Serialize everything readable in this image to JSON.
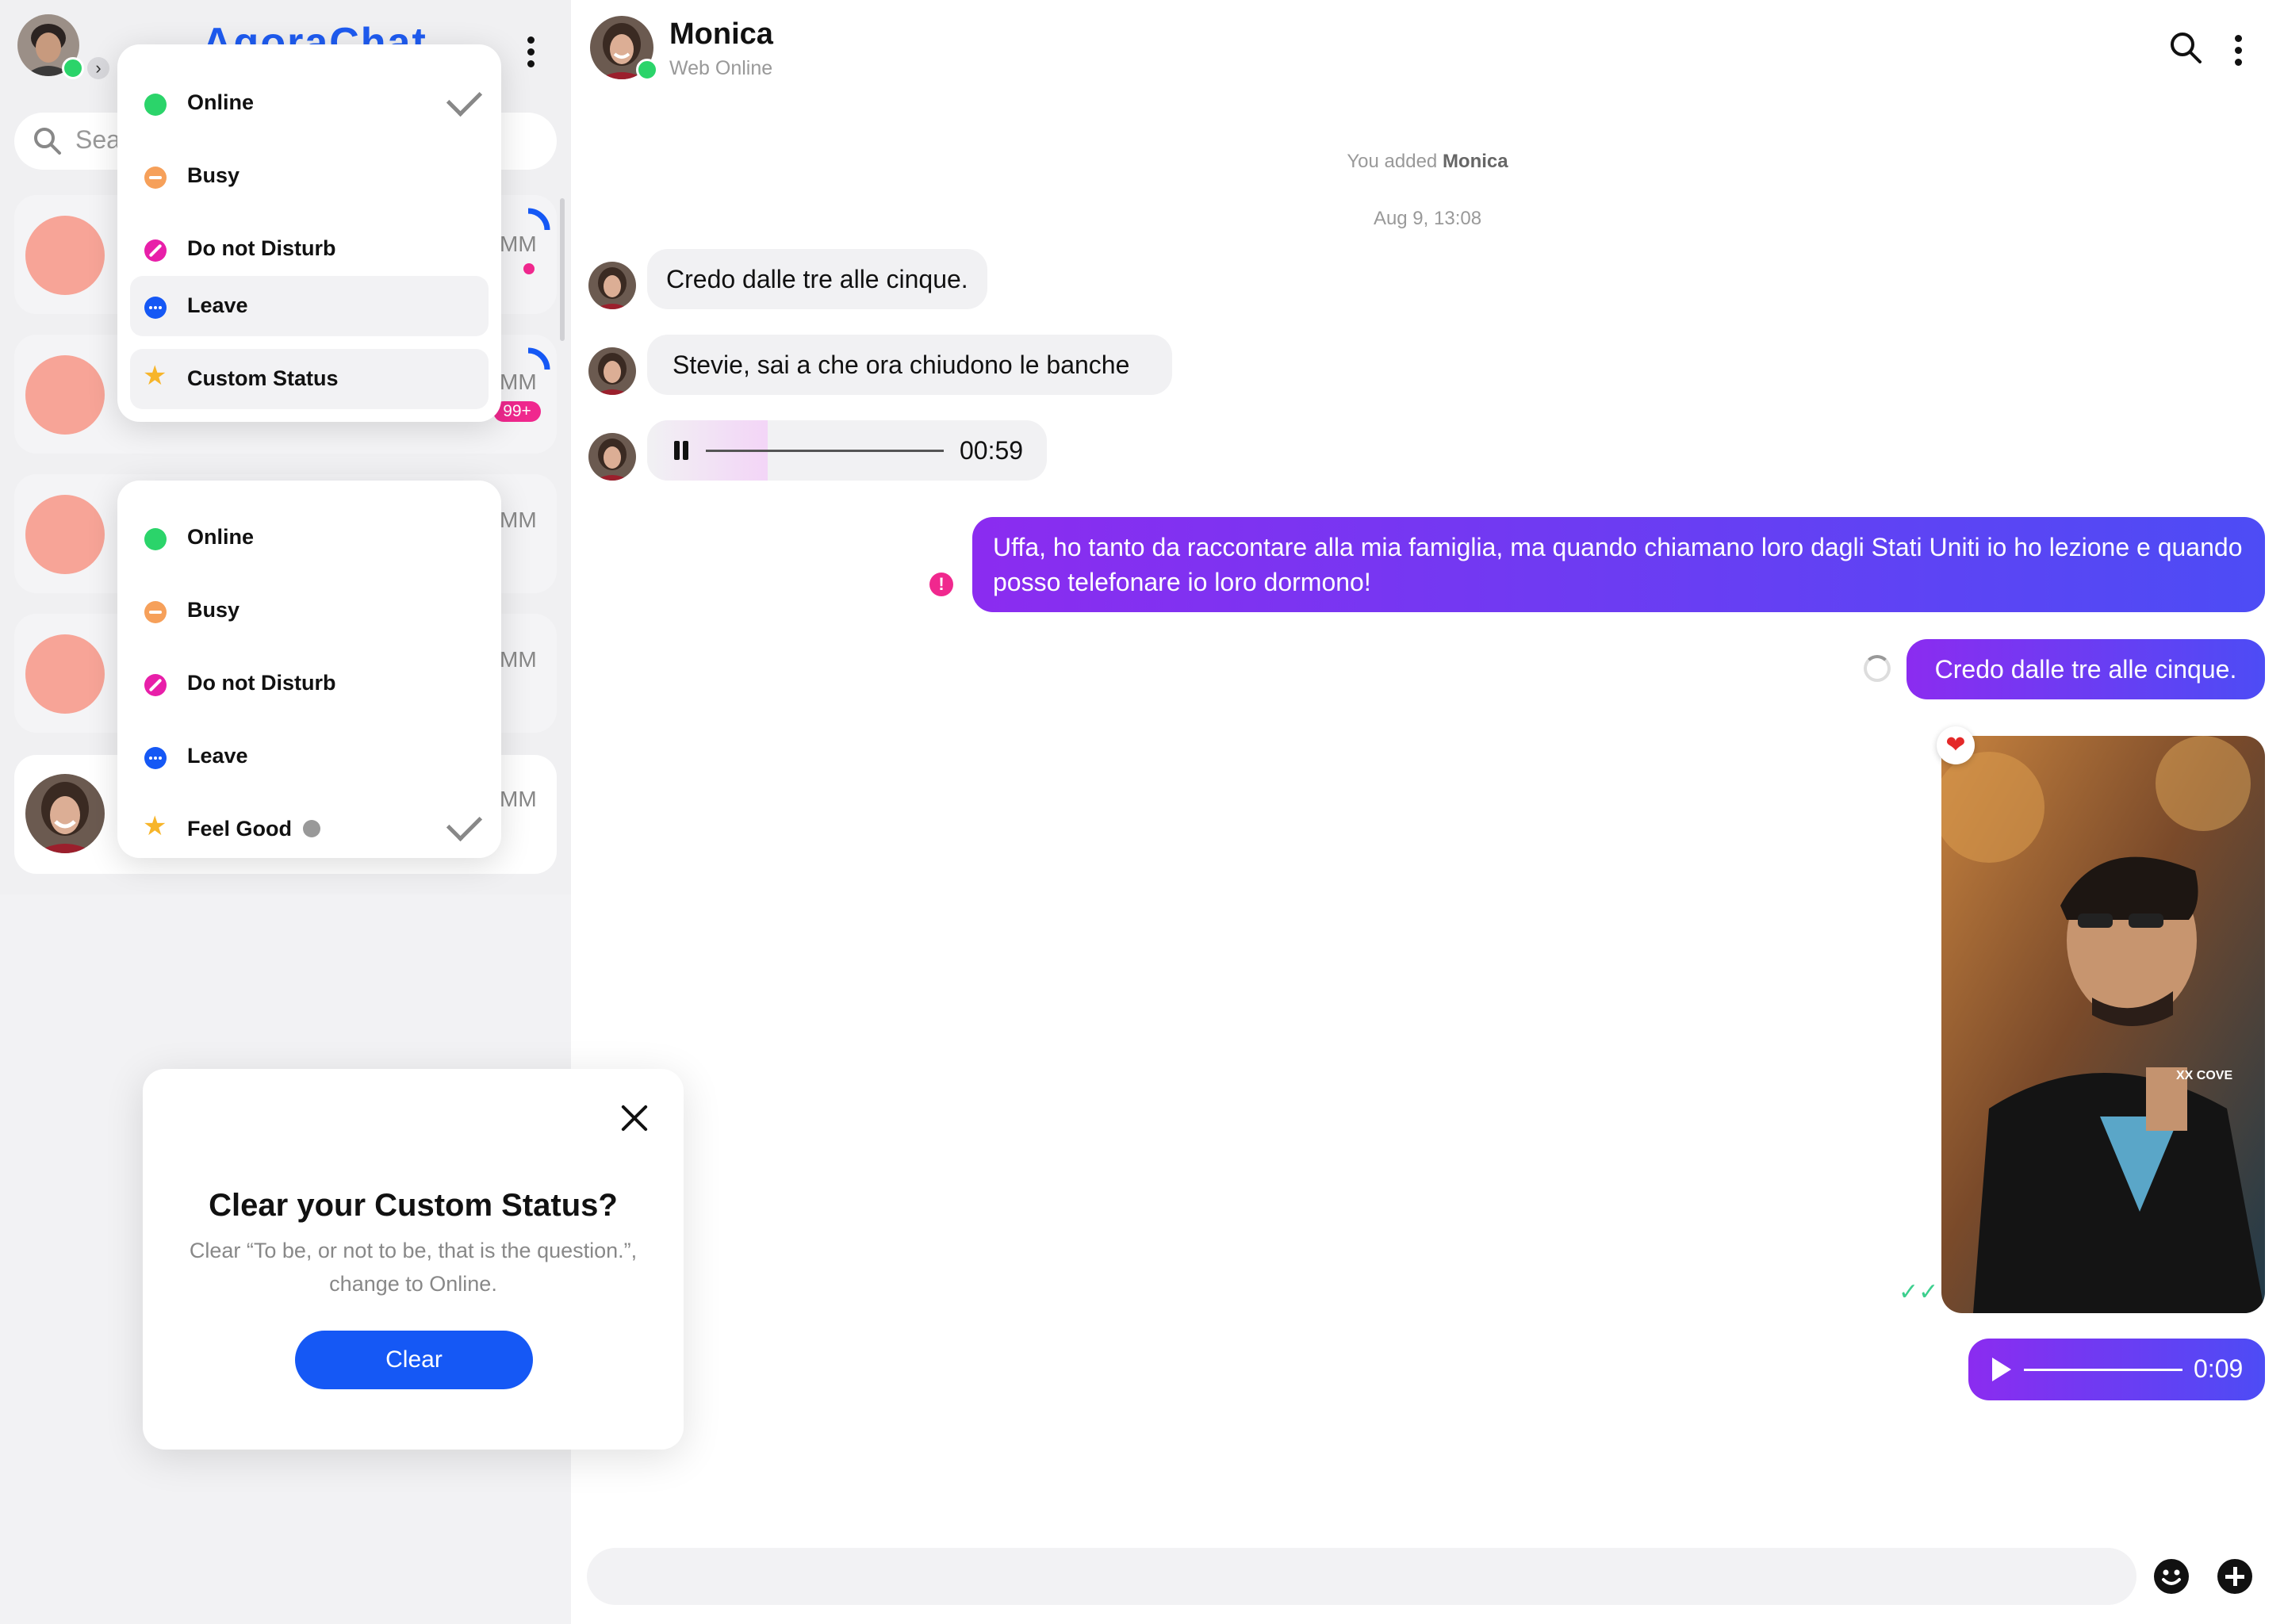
{
  "sidebar": {
    "app_title": "AgoraChat",
    "search_placeholder": "Search",
    "conversations": [
      {
        "time": "MM"
      },
      {
        "time": "MM",
        "badge": "99+"
      },
      {
        "time": "MM"
      },
      {
        "time": "MM"
      },
      {
        "time": "MM"
      }
    ]
  },
  "presence_menu": {
    "items": [
      {
        "label": "Online",
        "icon": "green-dot-icon",
        "checked": true
      },
      {
        "label": "Busy",
        "icon": "busy-icon"
      },
      {
        "label": "Do not Disturb",
        "icon": "do-not-disturb-icon"
      },
      {
        "label": "Leave",
        "icon": "leave-icon"
      },
      {
        "label": "Custom Status",
        "icon": "star-icon"
      }
    ]
  },
  "presence_menu_2": {
    "items": [
      {
        "label": "Online",
        "icon": "green-dot-icon"
      },
      {
        "label": "Busy",
        "icon": "busy-icon"
      },
      {
        "label": "Do not Disturb",
        "icon": "do-not-disturb-icon"
      },
      {
        "label": "Leave",
        "icon": "leave-icon"
      },
      {
        "label": "Feel Good",
        "icon": "star-icon",
        "checked": true
      }
    ]
  },
  "dialog": {
    "title": "Clear your Custom Status?",
    "body": "Clear “To be, or not to be, that is the question.”, change to Online.",
    "button": "Clear"
  },
  "chat": {
    "contact_name": "Monica",
    "contact_status": "Web Online",
    "system_added_prefix": "You added ",
    "system_added_name": "Monica",
    "timestamp": "Aug 9, 13:08",
    "messages_in": [
      "Credo dalle tre alle cinque.",
      "Stevie, sai a che ora chiudono le banche"
    ],
    "audio_in_duration": "00:59",
    "audio_in_progress": 0.25,
    "message_out_1": "Uffa, ho tanto da raccontare alla mia famiglia, ma quando chiamano loro dagli Stati Uniti io ho lezione e quando posso telefonare io loro dormono!",
    "message_out_2": "Credo dalle tre alle cinque.",
    "audio_out_duration": "0:09",
    "photo_text": "XX COVE",
    "heart": "❤",
    "error_mark": "!",
    "read_tick": "✓✓"
  },
  "colors": {
    "accent": "#1558f5",
    "outgoing_start": "#8b2cf0",
    "outgoing_end": "#4d4cf5",
    "online": "#2bd46a",
    "busy": "#f6a05a",
    "dnd": "#e81fa9",
    "leave": "#1558f5",
    "unread": "#f0288e",
    "avatar_placeholder": "#f7a497"
  }
}
